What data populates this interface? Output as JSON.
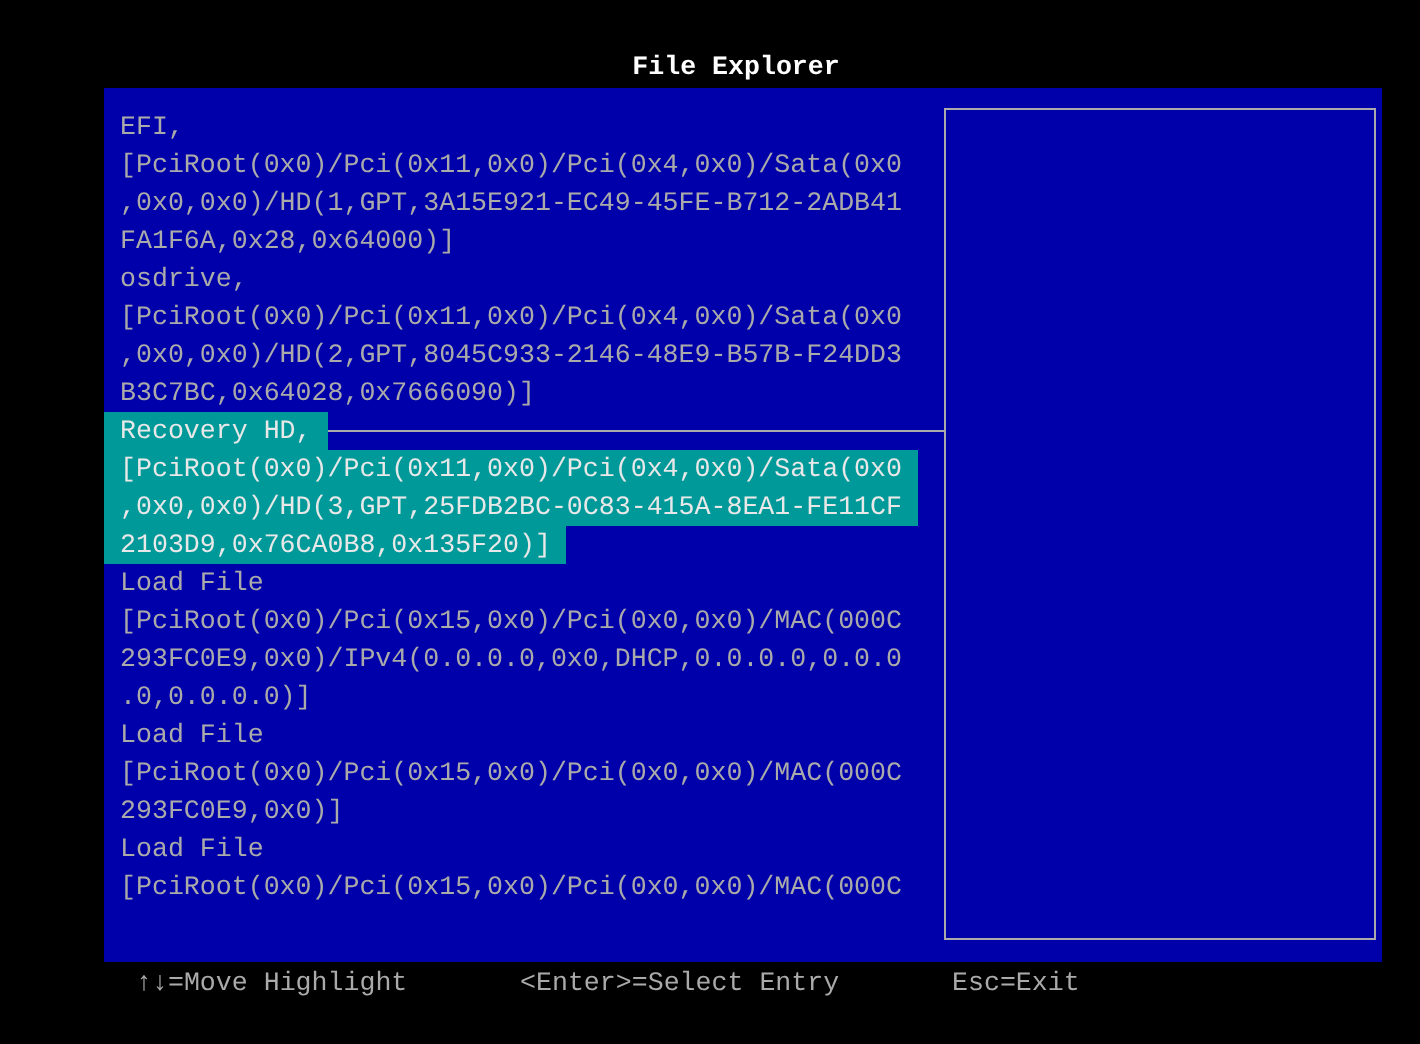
{
  "window": {
    "title": "File Explorer"
  },
  "entries": [
    {
      "selected": false,
      "lines": [
        "EFI,",
        "[PciRoot(0x0)/Pci(0x11,0x0)/Pci(0x4,0x0)/Sata(0x0",
        ",0x0,0x0)/HD(1,GPT,3A15E921-EC49-45FE-B712-2ADB41",
        "FA1F6A,0x28,0x64000)]"
      ]
    },
    {
      "selected": false,
      "lines": [
        "osdrive,",
        "[PciRoot(0x0)/Pci(0x11,0x0)/Pci(0x4,0x0)/Sata(0x0",
        ",0x0,0x0)/HD(2,GPT,8045C933-2146-48E9-B57B-F24DD3",
        "B3C7BC,0x64028,0x7666090)]"
      ]
    },
    {
      "selected": true,
      "lines": [
        "Recovery HD,",
        "[PciRoot(0x0)/Pci(0x11,0x0)/Pci(0x4,0x0)/Sata(0x0",
        ",0x0,0x0)/HD(3,GPT,25FDB2BC-0C83-415A-8EA1-FE11CF",
        "2103D9,0x76CA0B8,0x135F20)]"
      ]
    },
    {
      "selected": false,
      "lines": [
        "Load File",
        "[PciRoot(0x0)/Pci(0x15,0x0)/Pci(0x0,0x0)/MAC(000C",
        "293FC0E9,0x0)/IPv4(0.0.0.0,0x0,DHCP,0.0.0.0,0.0.0",
        ".0,0.0.0.0)]"
      ]
    },
    {
      "selected": false,
      "lines": [
        "Load File",
        "[PciRoot(0x0)/Pci(0x15,0x0)/Pci(0x0,0x0)/MAC(000C",
        "293FC0E9,0x0)]"
      ]
    },
    {
      "selected": false,
      "lines": [
        "Load File",
        "[PciRoot(0x0)/Pci(0x15,0x0)/Pci(0x0,0x0)/MAC(000C"
      ]
    }
  ],
  "footer": [
    "↑↓=Move Highlight",
    "<Enter>=Select Entry",
    "Esc=Exit"
  ]
}
